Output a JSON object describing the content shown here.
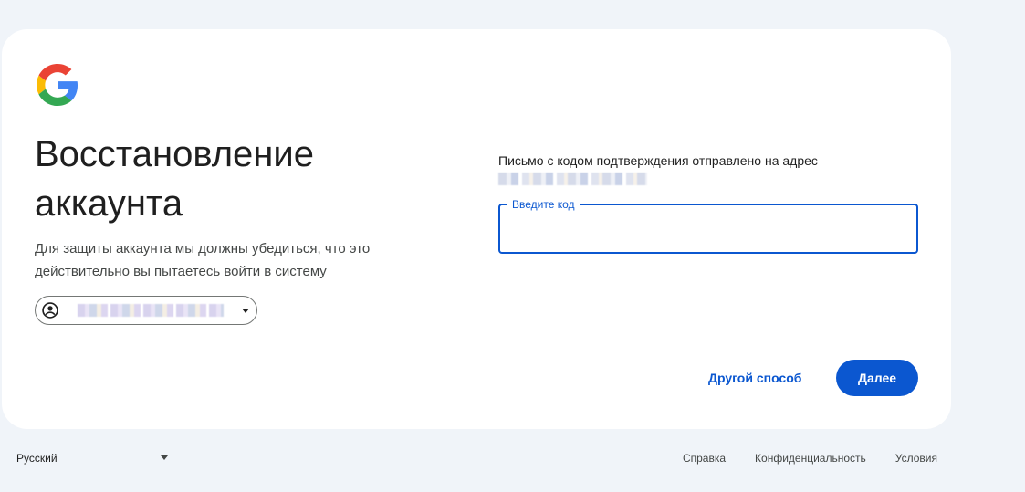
{
  "heading": {
    "title": "Восстановление аккаунта",
    "subtitle": "Для защиты аккаунта мы должны убедиться, что это действительно вы пытаетесь войти в систему"
  },
  "account": {
    "icon": "account-circle-icon"
  },
  "verification": {
    "info": "Письмо с кодом подтверждения отправлено на адрес",
    "code_label": "Введите код",
    "code_value": ""
  },
  "actions": {
    "other_label": "Другой способ",
    "next_label": "Далее"
  },
  "footer": {
    "language": "Русский",
    "links": [
      "Справка",
      "Конфиденциальность",
      "Условия"
    ]
  },
  "colors": {
    "accent": "#0b57d0",
    "page_background": "#f0f4f9",
    "card_background": "#ffffff"
  }
}
